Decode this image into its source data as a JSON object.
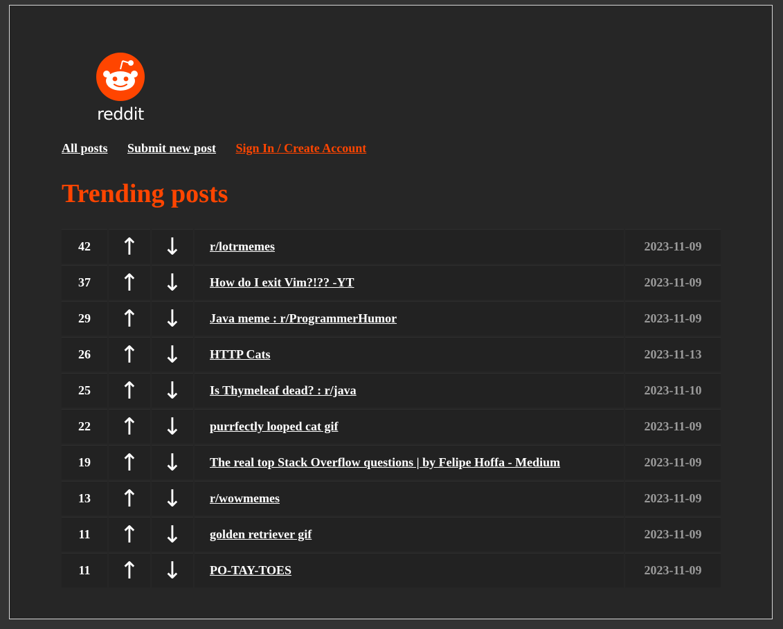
{
  "logo": {
    "wordmark": "reddit",
    "brand_color": "#ff4500"
  },
  "nav": {
    "all_posts": "All posts",
    "submit": "Submit new post",
    "sign_in": "Sign In / Create Account"
  },
  "heading": "Trending posts",
  "arrows": {
    "up": "↑",
    "down": "↓"
  },
  "posts": [
    {
      "score": "42",
      "title": "r/lotrmemes",
      "date": "2023-11-09"
    },
    {
      "score": "37",
      "title": "How do I exit Vim?!?? -YT",
      "date": "2023-11-09"
    },
    {
      "score": "29",
      "title": "Java meme : r/ProgrammerHumor",
      "date": "2023-11-09"
    },
    {
      "score": "26",
      "title": "HTTP Cats",
      "date": "2023-11-13"
    },
    {
      "score": "25",
      "title": "Is Thymeleaf dead? : r/java",
      "date": "2023-11-10"
    },
    {
      "score": "22",
      "title": "purrfectly looped cat gif",
      "date": "2023-11-09"
    },
    {
      "score": "19",
      "title": "The real top Stack Overflow questions | by Felipe Hoffa - Medium",
      "date": "2023-11-09"
    },
    {
      "score": "13",
      "title": "r/wowmemes",
      "date": "2023-11-09"
    },
    {
      "score": "11",
      "title": "golden retriever gif",
      "date": "2023-11-09"
    },
    {
      "score": "11",
      "title": "PO-TAY-TOES",
      "date": "2023-11-09"
    }
  ]
}
